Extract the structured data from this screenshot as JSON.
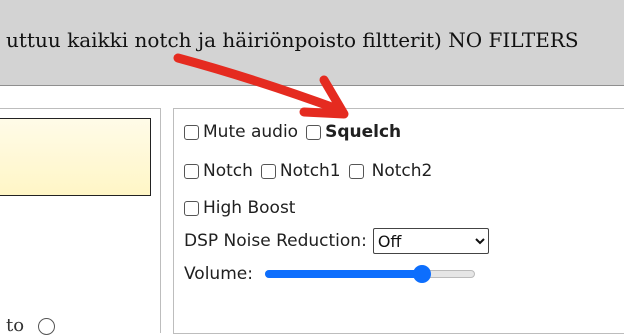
{
  "banner": {
    "text": "uttuu kaikki notch ja häiriönpoisto filtterit) NO FILTERS"
  },
  "left": {
    "cut_text": "to"
  },
  "controls": {
    "mute_audio": {
      "label": "Mute audio",
      "checked": false
    },
    "squelch": {
      "label": "Squelch",
      "checked": false
    },
    "notch": {
      "label": "Notch",
      "checked": false
    },
    "notch1": {
      "label": "Notch1",
      "checked": false
    },
    "notch2": {
      "label": "Notch2",
      "checked": false
    },
    "high_boost": {
      "label": "High Boost",
      "checked": false
    },
    "dsp_noise_reduction": {
      "label": "DSP Noise Reduction:",
      "selected": "Off"
    },
    "volume": {
      "label": "Volume:",
      "level_fraction": 0.75
    }
  },
  "colors": {
    "annotation_arrow": "#e52b20",
    "slider_accent": "#0d6efd"
  }
}
